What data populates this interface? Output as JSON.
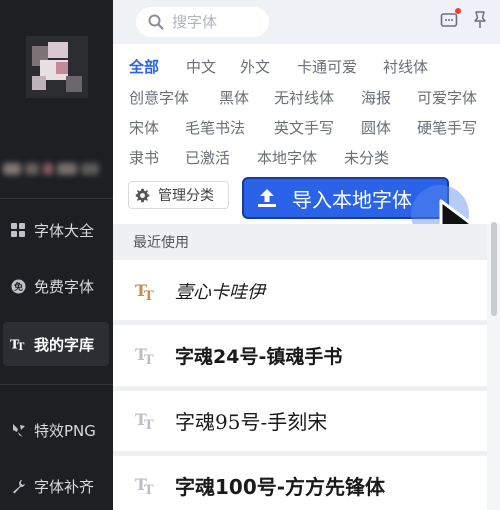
{
  "sidebar": {
    "nav": [
      {
        "label": "字体大全",
        "icon": "grid-icon"
      },
      {
        "label": "免费字体",
        "icon": "free-badge-icon"
      },
      {
        "label": "我的字库",
        "icon": "font-tt-icon"
      },
      {
        "label": "特效PNG",
        "icon": "sparkle-icon"
      },
      {
        "label": "字体补齐",
        "icon": "wrench-icon"
      }
    ]
  },
  "topbar": {
    "search_placeholder": "搜字体"
  },
  "categories": [
    "全部",
    "中文",
    "外文",
    "卡通可爱",
    "衬线体",
    "创意字体",
    "黑体",
    "无衬线体",
    "海报",
    "可爱字体",
    "宋体",
    "毛笔书法",
    "英文手写",
    "圆体",
    "硬笔手写",
    "隶书",
    "已激活",
    "本地字体",
    "未分类"
  ],
  "active_category": "全部",
  "actions": {
    "manage_label": "管理分类",
    "import_label": "导入本地字体"
  },
  "recent": {
    "heading": "最近使用",
    "fonts": [
      {
        "name": "壹心卡哇伊",
        "icon_color": "#c98a4b"
      },
      {
        "name": "字魂24号-镇魂手书",
        "icon_color": "#b9bec7"
      },
      {
        "name": "字魂95号-手刻宋",
        "icon_color": "#b9bec7"
      },
      {
        "name": "字魂100号-方方先锋体",
        "icon_color": "#b9bec7"
      }
    ]
  },
  "colors": {
    "accent": "#2a63e8",
    "sidebar_bg": "#1d1f23",
    "notification": "#ff3b30"
  }
}
